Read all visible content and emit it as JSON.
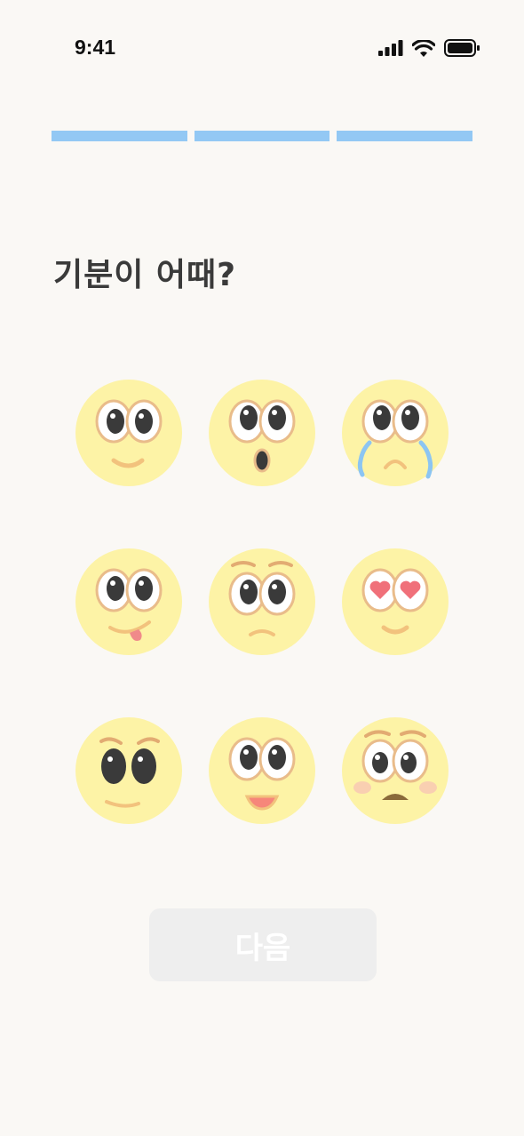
{
  "status_bar": {
    "time": "9:41"
  },
  "progress": {
    "steps_total": 3,
    "steps_completed": 3,
    "color": "#93c8f4"
  },
  "question": "기분이 어때?",
  "moods": [
    {
      "name": "smiling-face",
      "icon": "smile-icon"
    },
    {
      "name": "surprised-face",
      "icon": "surprised-icon"
    },
    {
      "name": "crying-face",
      "icon": "crying-icon"
    },
    {
      "name": "playful-face",
      "icon": "tongue-icon"
    },
    {
      "name": "worried-face",
      "icon": "worried-icon"
    },
    {
      "name": "love-face",
      "icon": "heart-eyes-icon"
    },
    {
      "name": "smirking-face",
      "icon": "smirk-icon"
    },
    {
      "name": "happy-face",
      "icon": "grin-icon"
    },
    {
      "name": "embarrassed-face",
      "icon": "embarrassed-icon"
    }
  ],
  "next_button": {
    "label": "다음",
    "enabled": false
  },
  "colors": {
    "background": "#faf8f5",
    "face": "#fdf3a6",
    "eye_ring": "#e9bc8a",
    "button_bg": "#eeeeee"
  }
}
